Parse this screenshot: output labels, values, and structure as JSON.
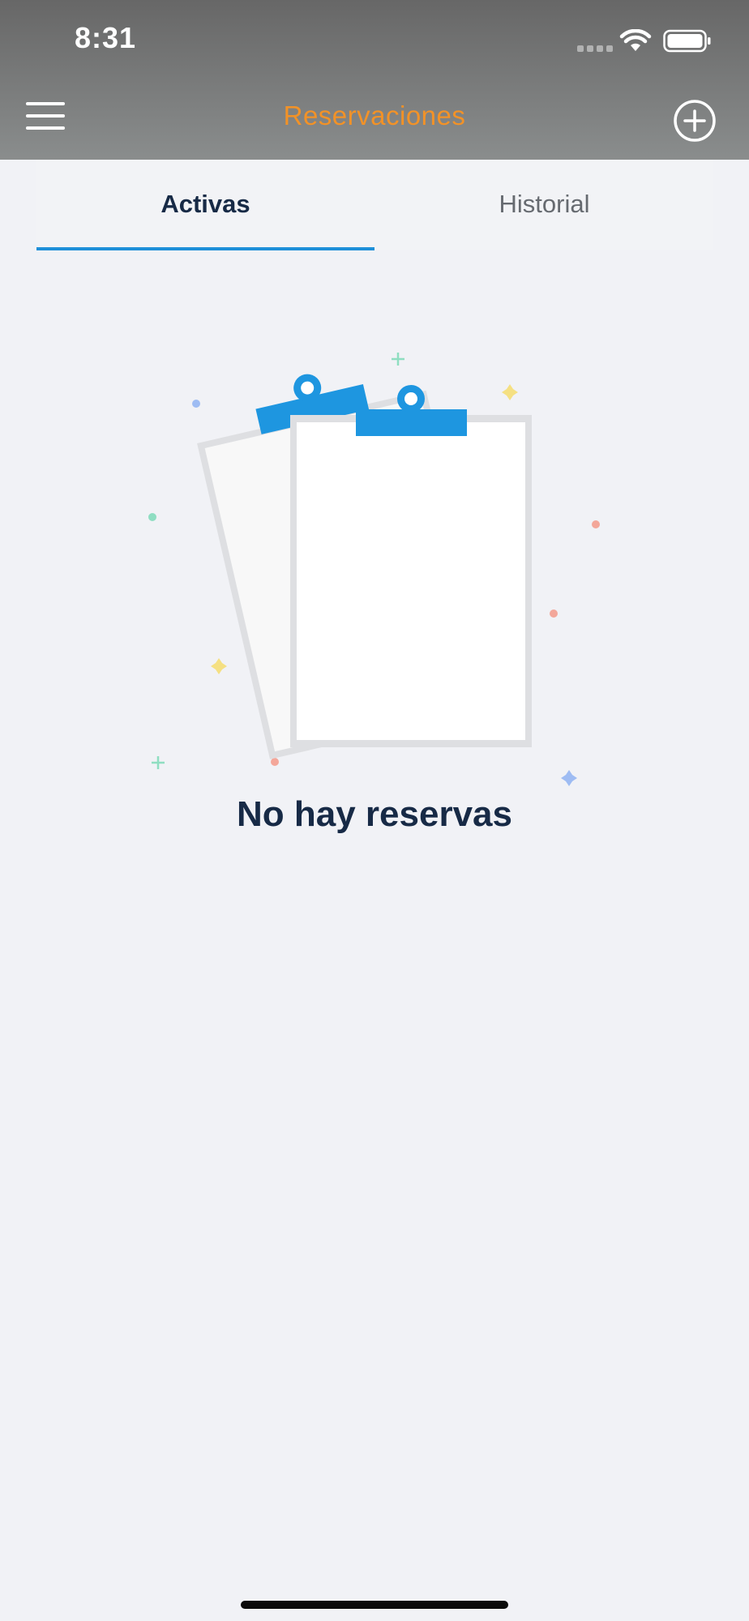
{
  "status_bar": {
    "time": "8:31"
  },
  "nav": {
    "title": "Reservaciones",
    "menu_icon": "hamburger-menu-icon",
    "add_icon": "add-circle-icon"
  },
  "tabs": [
    {
      "label": "Activas",
      "selected": true
    },
    {
      "label": "Historial",
      "selected": false
    }
  ],
  "empty_state": {
    "illustration": "clipboards-illustration",
    "message": "No hay reservas"
  },
  "colors": {
    "accent_title": "#f29227",
    "tab_indicator": "#1e8fd9",
    "clip_blue": "#1e96e0",
    "text_dark": "#172a46",
    "background": "#f1f2f6"
  }
}
